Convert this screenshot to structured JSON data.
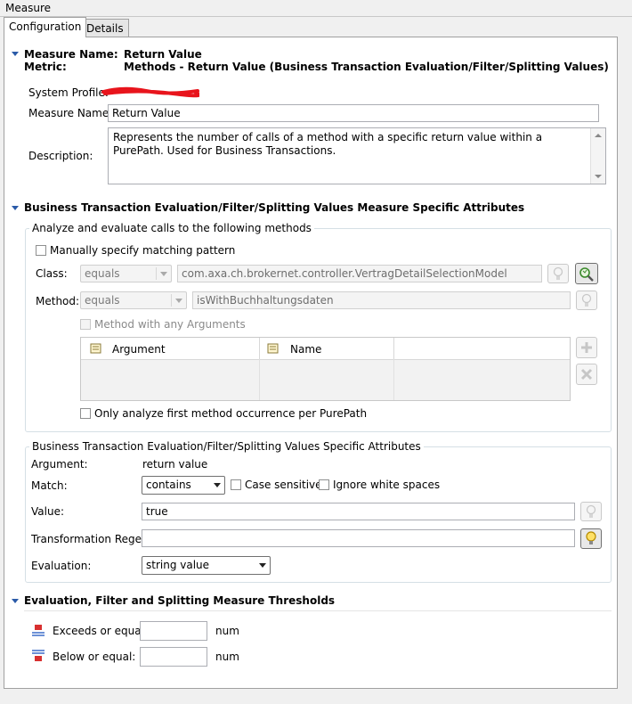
{
  "window_title": "Measure",
  "tabs": [
    {
      "label": "Configuration"
    },
    {
      "label": "Details"
    }
  ],
  "header": {
    "measure_name_label": "Measure Name:",
    "measure_name_value": "Return Value",
    "metric_label": "Metric:",
    "metric_value": "Methods - Return Value (Business Transaction Evaluation/Filter/Splitting Values)"
  },
  "general": {
    "system_profile_label": "System Profile:",
    "measure_name_label": "Measure Name:",
    "measure_name_value": "Return Value",
    "description_label": "Description:",
    "description_value": "Represents the number of calls of a method with a specific return value within a PurePath. Used for Business Transactions."
  },
  "specific_section": {
    "title": "Business Transaction Evaluation/Filter/Splitting Values Measure Specific Attributes",
    "analyze_group_title": "Analyze and evaluate calls to the following methods",
    "manual_pattern_label": "Manually specify matching pattern",
    "class_label": "Class:",
    "class_match": "equals",
    "class_value": "com.axa.ch.brokernet.controller.VertragDetailSelectionModel",
    "method_label": "Method:",
    "method_match": "equals",
    "method_value": "isWithBuchhaltungsdaten",
    "any_args_label": "Method with any Arguments",
    "columns": [
      "Argument",
      "Name"
    ],
    "first_occurrence_label": "Only analyze first method occurrence per PurePath"
  },
  "bt_attributes": {
    "group_title": "Business Transaction Evaluation/Filter/Splitting Values Specific Attributes",
    "argument_label": "Argument:",
    "argument_value": "return value",
    "match_label": "Match:",
    "match_value": "contains",
    "case_sensitive_label": "Case sensitive",
    "ignore_ws_label": "Ignore white spaces",
    "value_label": "Value:",
    "value_value": "true",
    "regex_label": "Transformation Regex:",
    "regex_value": "",
    "evaluation_label": "Evaluation:",
    "evaluation_value": "string value"
  },
  "thresholds": {
    "title": "Evaluation, Filter and Splitting Measure Thresholds",
    "exceeds_label": "Exceeds or equal:",
    "below_label": "Below or equal:",
    "unit": "num"
  }
}
